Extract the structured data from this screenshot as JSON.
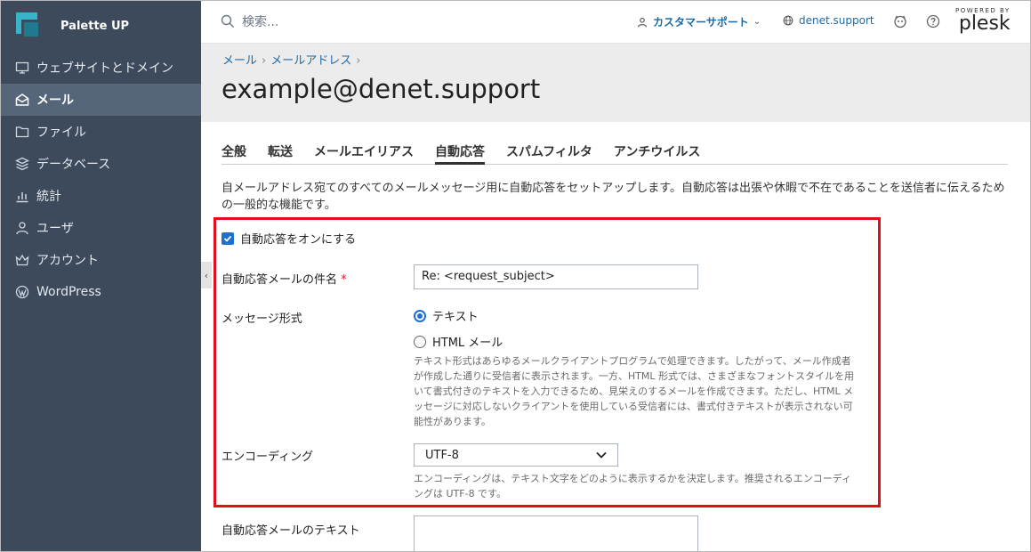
{
  "brand": {
    "name": "Palette UP"
  },
  "sidebar": {
    "items": [
      {
        "label": "ウェブサイトとドメイン",
        "icon": "monitor-icon"
      },
      {
        "label": "メール",
        "icon": "mail-icon",
        "active": true
      },
      {
        "label": "ファイル",
        "icon": "folder-icon"
      },
      {
        "label": "データベース",
        "icon": "database-icon"
      },
      {
        "label": "統計",
        "icon": "chart-icon"
      },
      {
        "label": "ユーザ",
        "icon": "user-icon"
      },
      {
        "label": "アカウント",
        "icon": "crown-icon"
      },
      {
        "label": "WordPress",
        "icon": "wordpress-icon"
      }
    ]
  },
  "topbar": {
    "search_placeholder": "検索...",
    "support_label": "カスタマーサポート",
    "domain_label": "denet.support",
    "powered_by": "POWERED BY",
    "plesk": "plesk"
  },
  "breadcrumb": {
    "items": [
      "メール",
      "メールアドレス"
    ]
  },
  "page_title": "example@denet.support",
  "tabs": [
    "全般",
    "転送",
    "メールエイリアス",
    "自動応答",
    "スパムフィルタ",
    "アンチウイルス"
  ],
  "active_tab": "自動応答",
  "description": "自メールアドレス宛てのすべてのメールメッセージ用に自動応答をセットアップします。自動応答は出張や休暇で不在であることを送信者に伝えるための一般的な機能です。",
  "form": {
    "enable_label": "自動応答をオンにする",
    "enable_checked": true,
    "subject_label": "自動応答メールの件名",
    "required_mark": "*",
    "subject_value": "Re: <request_subject>",
    "format_label": "メッセージ形式",
    "format_text": "テキスト",
    "format_html": "HTML メール",
    "format_selected": "テキスト",
    "format_hint": "テキスト形式はあらゆるメールクライアントプログラムで処理できます。したがって、メール作成者が作成した通りに受信者に表示されます。一方、HTML 形式では、さまざまなフォントスタイルを用いて書式付きのテキストを入力できるため、見栄えのするメールを作成できます。ただし、HTML メッセージに対応しないクライアントを使用している受信者には、書式付きテキストが表示されない可能性があります。",
    "encoding_label": "エンコーディング",
    "encoding_value": "UTF-8",
    "encoding_hint": "エンコーディングは、テキスト文字をどのように表示するかを決定します。推奨されるエンコーディングは UTF-8 です。",
    "body_label": "自動応答メールのテキスト",
    "body_value": ""
  },
  "colors": {
    "sidebar": "#3c4a5c",
    "accent": "#1f6fd0",
    "highlight": "#e0101a"
  }
}
